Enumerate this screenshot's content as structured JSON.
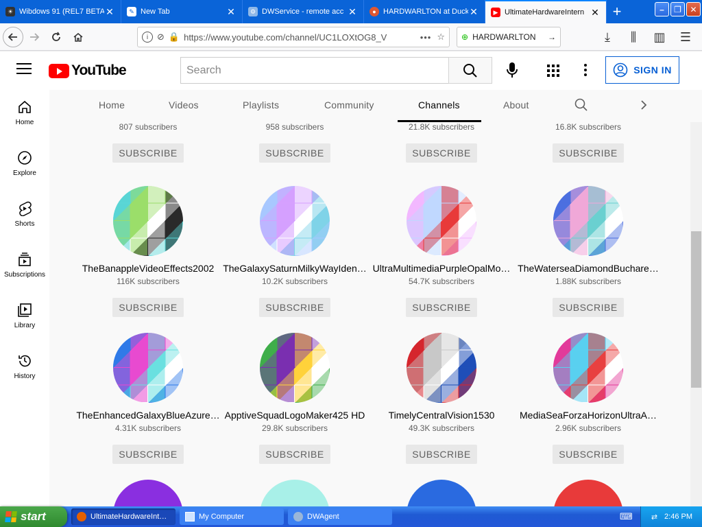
{
  "browser": {
    "tabs": [
      {
        "title": "Wibdows 91 (REL7 BETA",
        "favicon": "wibdows-icon",
        "active": false
      },
      {
        "title": "New Tab",
        "favicon": "new-tab-icon",
        "active": false
      },
      {
        "title": "DWService - remote acc",
        "favicon": "dwservice-gear-icon",
        "active": false
      },
      {
        "title": "HARDWARLTON at Duck",
        "favicon": "duckduckgo-icon",
        "active": false
      },
      {
        "title": "UltimateHardwareIntern",
        "favicon": "youtube-icon",
        "active": true
      }
    ],
    "url": "https://www.youtube.com/channel/UC1LOXtOG8_V",
    "search_value": "HARDWARLTON"
  },
  "youtube": {
    "logo_text": "YouTube",
    "search_placeholder": "Search",
    "signin_label": "SIGN IN",
    "guide": [
      {
        "label": "Home",
        "icon": "home-icon"
      },
      {
        "label": "Explore",
        "icon": "compass-icon"
      },
      {
        "label": "Shorts",
        "icon": "shorts-icon"
      },
      {
        "label": "Subscriptions",
        "icon": "subscriptions-icon"
      },
      {
        "label": "Library",
        "icon": "library-icon"
      },
      {
        "label": "History",
        "icon": "history-icon"
      }
    ],
    "channel_tabs": [
      {
        "label": "Home",
        "active": false
      },
      {
        "label": "Videos",
        "active": false
      },
      {
        "label": "Playlists",
        "active": false
      },
      {
        "label": "Community",
        "active": false
      },
      {
        "label": "Channels",
        "active": true
      },
      {
        "label": "About",
        "active": false
      }
    ],
    "subscribe_label": "SUBSCRIBE",
    "partial_row": [
      {
        "subs": "807 subscribers"
      },
      {
        "subs": "958 subscribers"
      },
      {
        "subs": "21.8K subscribers"
      },
      {
        "subs": "16.8K subscribers"
      }
    ],
    "channels": [
      {
        "name": "TheBanappleVideoEffects2002",
        "subs": "116K subscribers",
        "colors": [
          "#5ad6d6",
          "#9bde6a",
          "#ffffff",
          "#2a2a2a"
        ]
      },
      {
        "name": "TheGalaxySaturnMilkyWayIden…",
        "subs": "10.2K subscribers",
        "colors": [
          "#a8c8ff",
          "#d6a0ff",
          "#ffffff",
          "#7fd3e8"
        ]
      },
      {
        "name": "UltraMultimediaPurpleOpalMo…",
        "subs": "54.7K subscribers",
        "colors": [
          "#f2b8ff",
          "#c0d8ff",
          "#e83a3a",
          "#ffffff"
        ]
      },
      {
        "name": "TheWaterseaDiamondBuchare…",
        "subs": "1.88K subscribers",
        "colors": [
          "#4c6fe0",
          "#f0a8d8",
          "#6ad0d0",
          "#ffffff"
        ]
      },
      {
        "name": "TheEnhancedGalaxyBlueAzure…",
        "subs": "4.31K subscribers",
        "colors": [
          "#2f7ae8",
          "#e84ad0",
          "#6ae0e0",
          "#ffffff"
        ]
      },
      {
        "name": "ApptiveSquadLogoMaker425 HD",
        "subs": "29.8K subscribers",
        "colors": [
          "#3fae4a",
          "#7a2fb0",
          "#ffd23a",
          "#ffffff"
        ]
      },
      {
        "name": "TimelyCentralVision1530",
        "subs": "49.3K subscribers",
        "colors": [
          "#d6262e",
          "#c8c8c8",
          "#ffffff",
          "#1f4fb8"
        ]
      },
      {
        "name": "MediaSeaForzaHorizonUltraA…",
        "subs": "2.96K subscribers",
        "colors": [
          "#e23a9a",
          "#5ad0f0",
          "#e84040",
          "#ffffff"
        ]
      }
    ],
    "bottom_row_colors": [
      [
        "#8a2fe0",
        "#ffffff"
      ],
      [
        "#a8f0e8",
        "#ffffff"
      ],
      [
        "#2a6ae0",
        "#ffffff"
      ],
      [
        "#e83a3a",
        "#a8d8ff"
      ]
    ]
  },
  "taskbar": {
    "start_label": "start",
    "tasks": [
      {
        "label": "UltimateHardwareInt…",
        "icon": "firefox-icon"
      },
      {
        "label": "My Computer",
        "icon": "my-computer-icon"
      },
      {
        "label": "DWAgent",
        "icon": "dwagent-icon"
      }
    ],
    "clock": "2:46 PM"
  }
}
